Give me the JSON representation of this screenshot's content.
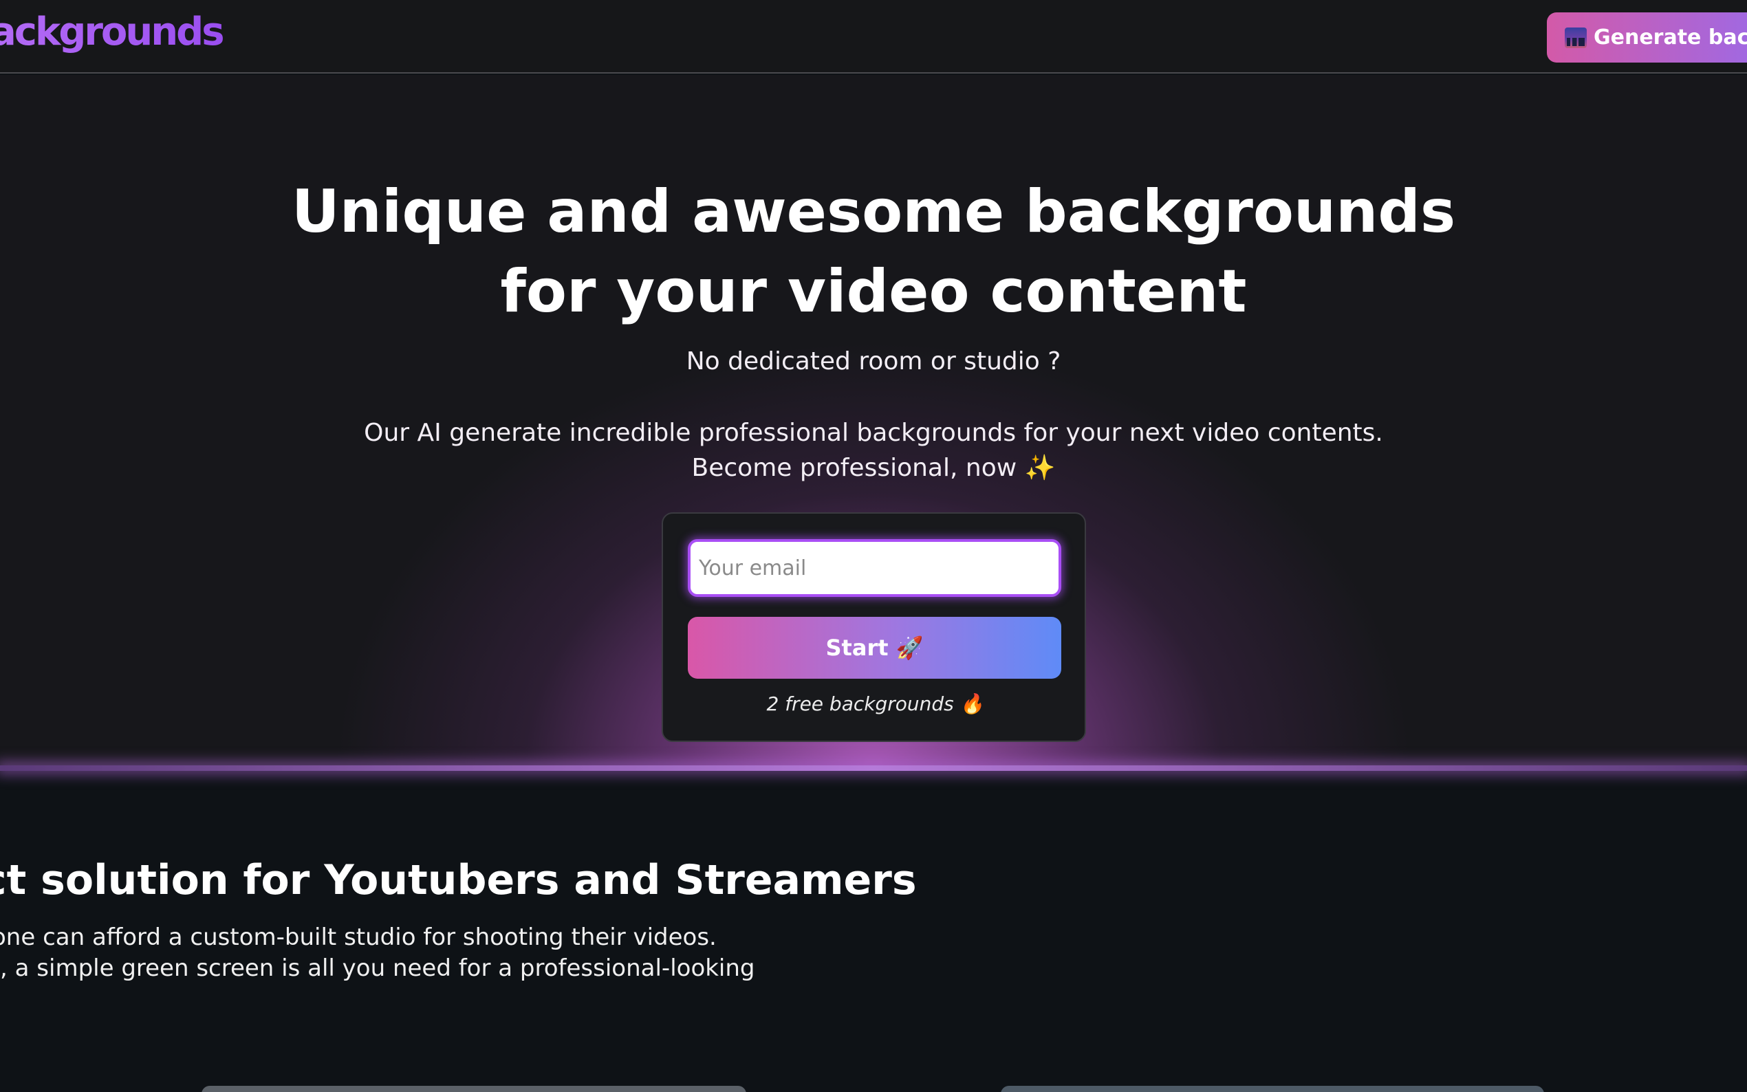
{
  "header": {
    "logo_text": "ackgrounds",
    "generate_button_label": "Generate back",
    "generate_button_icon": "city-night-icon"
  },
  "hero": {
    "title_line1": "Unique and awesome backgrounds",
    "title_line2": "for your video content",
    "subtitle": "No dedicated room or studio ?",
    "description_line1": "Our AI generate incredible professional backgrounds for your next video contents.",
    "description_line2": "Become professional, now ✨"
  },
  "signup": {
    "email_placeholder": "Your email",
    "email_value": "",
    "start_label": "Start 🚀",
    "free_note": "2 free backgrounds 🔥"
  },
  "section": {
    "title": "ct solution for Youtubers and Streamers",
    "line1": "one can afford a custom-built studio for shooting their videos.",
    "line2": "I, a simple green screen is all you need for a professional-looking"
  },
  "colors": {
    "brand_purple": "#a855f7",
    "button_gradient_start": "#d957a8",
    "button_gradient_end": "#5f8bf7",
    "page_background": "#0e1216"
  }
}
